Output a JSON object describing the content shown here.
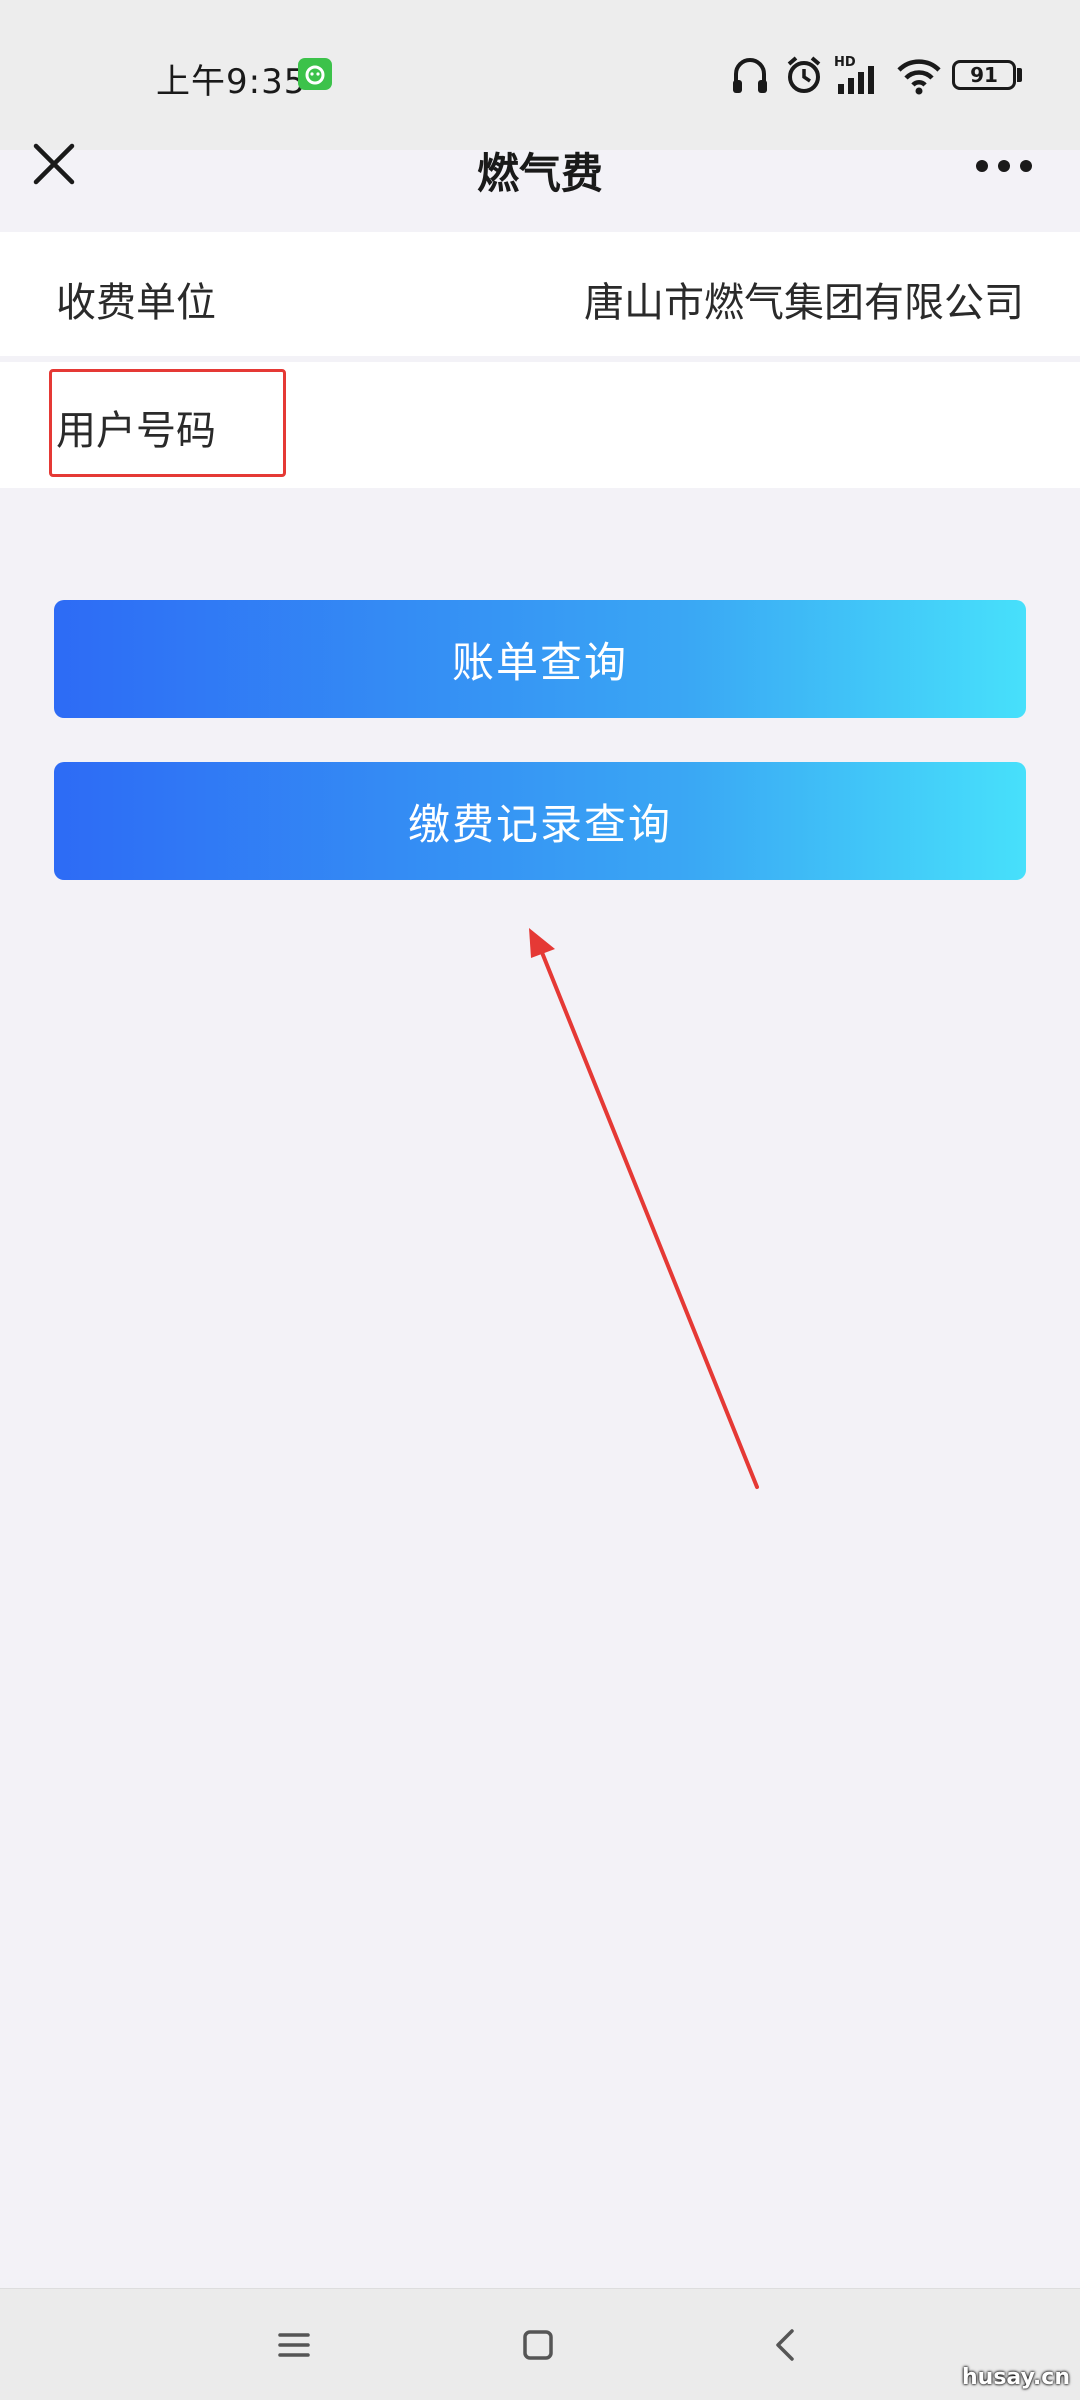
{
  "status_bar": {
    "time": "上午9:35",
    "battery": "91",
    "icons": [
      "headphones-icon",
      "alarm-icon",
      "hd-signal-icon",
      "wifi-icon",
      "battery-icon"
    ]
  },
  "header": {
    "title": "燃气费",
    "close_icon": "close-icon",
    "more_icon": "more-icon"
  },
  "form": {
    "payee_label": "收费单位",
    "payee_value": "唐山市燃气集团有限公司",
    "account_label": "用户号码",
    "account_value": ""
  },
  "buttons": {
    "bill_query": "账单查询",
    "payment_record_query": "缴费记录查询"
  },
  "nav": {
    "icons": [
      "menu-icon",
      "home-icon",
      "back-icon"
    ]
  },
  "annotations": {
    "color": "#e53935"
  },
  "watermark": "husay.cn",
  "colors": {
    "gradient_start": "#2d6bf5",
    "gradient_end": "#47e0fb",
    "background": "#f3f2f7"
  }
}
